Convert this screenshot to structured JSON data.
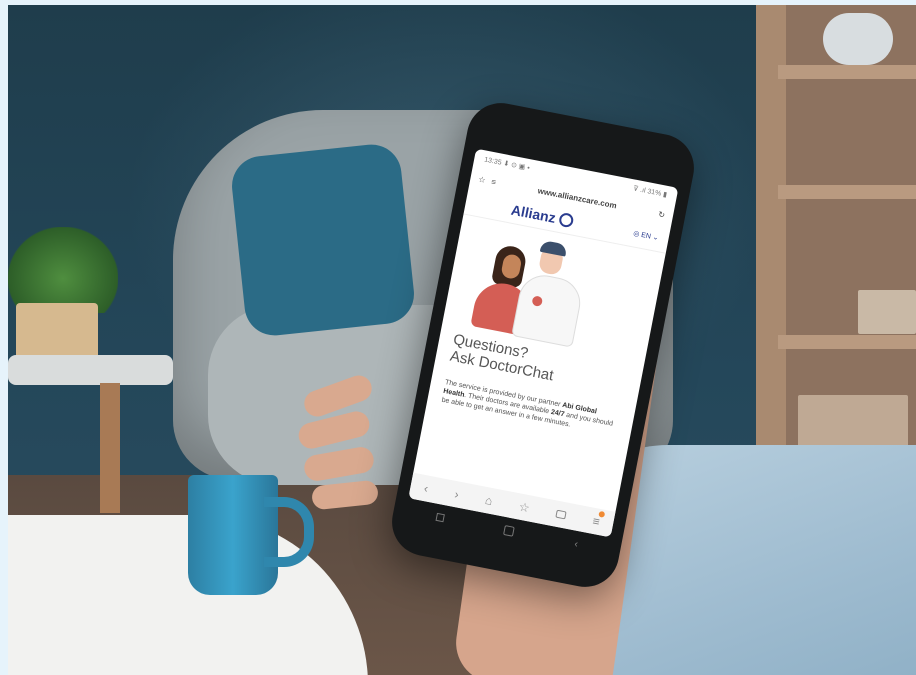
{
  "phone": {
    "status": {
      "time": "13:35",
      "left_icons": "⬇ ⊙ ▣ •",
      "right_icons": "⊽ .ıl 31%",
      "battery_glyph": "▮"
    },
    "browser": {
      "url": "www.allianzcare.com",
      "star_glyph": "☆",
      "tabs_glyph": "≡",
      "reload_glyph": "↻"
    },
    "header": {
      "brand": "Allianz",
      "language": "EN",
      "language_glyph": "◎",
      "chevron_glyph": "⌄"
    },
    "hero": {
      "headline_line1": "Questions?",
      "headline_line2": "Ask DoctorChat"
    },
    "description": {
      "part1": "The service is provided by our partner ",
      "partner": "Abi Global Health",
      "part2": ". Their doctors are available ",
      "availability": "24/7",
      "part3": " and you should be able to get an answer in a few minutes."
    },
    "nav": {
      "back": "‹",
      "forward": "›",
      "home": "⌂",
      "bookmark": "☆",
      "menu": "≡"
    },
    "android": {
      "recents": "",
      "home": "",
      "back": "‹"
    }
  }
}
